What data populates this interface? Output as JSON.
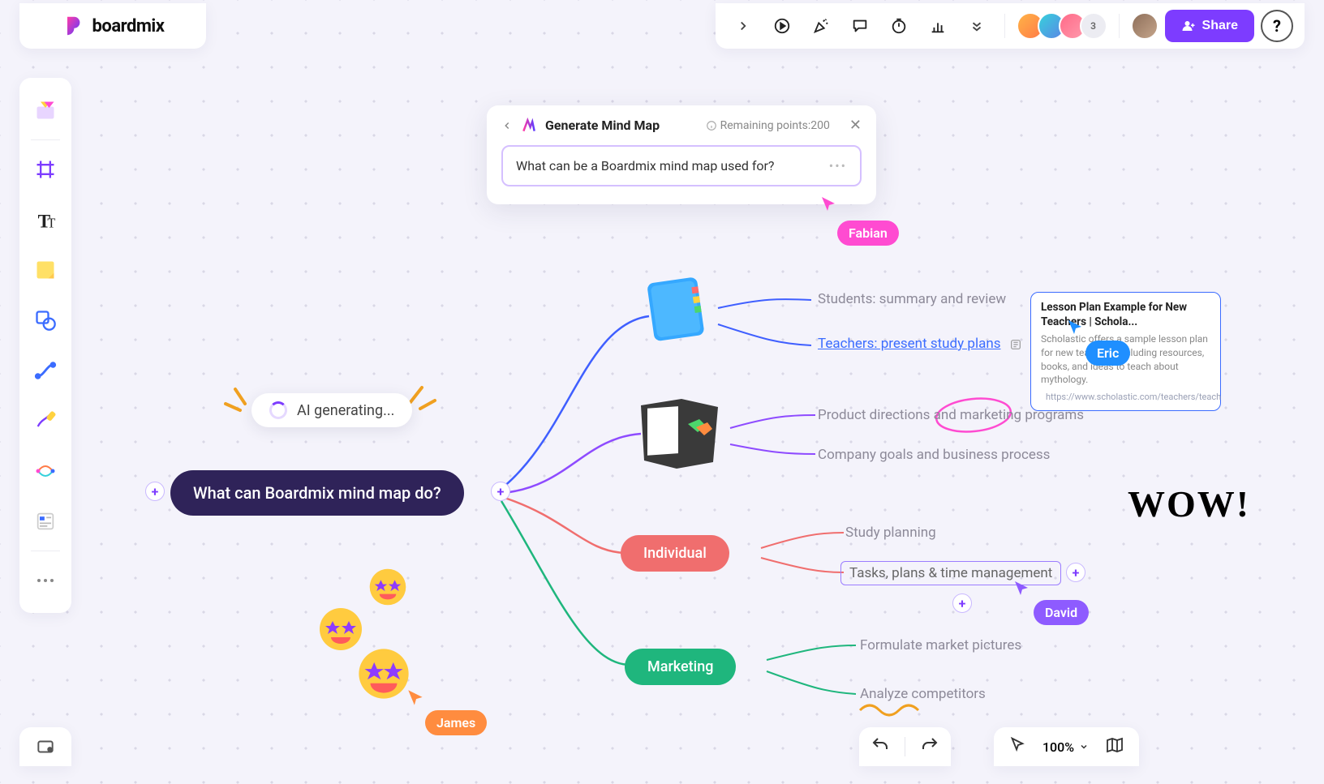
{
  "brand": {
    "name": "boardmix"
  },
  "topbar": {
    "share_label": "Share",
    "avatar_extra_count": "3"
  },
  "ai_panel": {
    "title": "Generate Mind Map",
    "points_label": "Remaining points:200",
    "input_text": "What can be a Boardmix mind map used for?"
  },
  "ai_status": {
    "label": "AI generating..."
  },
  "cursors": {
    "fabian": "Fabian",
    "eric": "Eric",
    "david": "David",
    "james": "James"
  },
  "mindmap": {
    "root": "What can Boardmix mind map do?",
    "individual_label": "Individual",
    "marketing_label": "Marketing",
    "leaves": {
      "students": "Students:  summary and review",
      "teachers": "Teachers: present study plans",
      "product": "Product directions and marketing programs",
      "company": "Company goals and business process",
      "study": "Study planning",
      "tasks": "Tasks, plans & time management",
      "formulate": "Formulate market pictures",
      "analyze": "Analyze competitors"
    }
  },
  "card": {
    "title": "Lesson Plan Example for New Teachers | Schola...",
    "body": "Scholastic offers a sample lesson plan for new teachers, including resources, books, and ideas to teach about mythology.",
    "url": "https://www.scholastic.com/teachers/teach"
  },
  "annotations": {
    "wow": "WOW!"
  },
  "zoom": {
    "level": "100%"
  }
}
